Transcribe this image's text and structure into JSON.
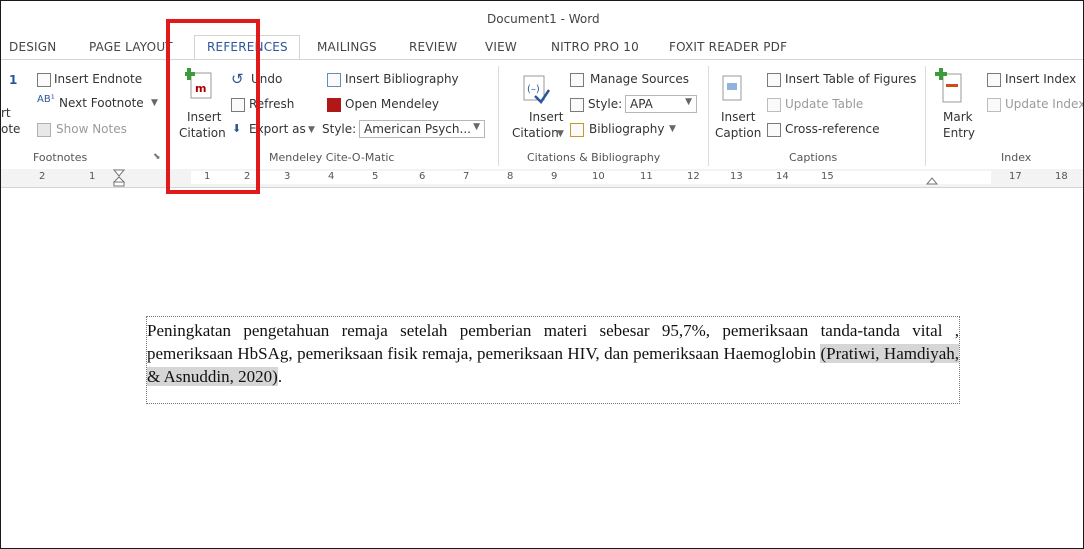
{
  "window": {
    "title": "Document1 - Word"
  },
  "tabs": [
    "DESIGN",
    "PAGE LAYOUT",
    "REFERENCES",
    "MAILINGS",
    "REVIEW",
    "VIEW",
    "NITRO PRO 10",
    "FOXIT READER PDF"
  ],
  "active_tab": "REFERENCES",
  "ribbon": {
    "footnotes": {
      "cut_labels": [
        "1",
        "rt",
        "ote"
      ],
      "insert_endnote": "Insert Endnote",
      "next_footnote": "Next Footnote",
      "show_notes": "Show Notes",
      "group_label": "Footnotes"
    },
    "mendeley": {
      "insert_citation": [
        "Insert",
        "Citation"
      ],
      "undo": "Undo",
      "refresh": "Refresh",
      "export_as": "Export as",
      "insert_bibliography": "Insert Bibliography",
      "open_mendeley": "Open Mendeley",
      "style_label": "Style:",
      "style_value": "American Psych...",
      "group_label": "Mendeley Cite-O-Matic"
    },
    "citations": {
      "insert_citation": [
        "Insert",
        "Citation"
      ],
      "manage_sources": "Manage Sources",
      "style_label": "Style:",
      "style_value": "APA",
      "bibliography": "Bibliography",
      "group_label": "Citations & Bibliography"
    },
    "captions": {
      "insert_caption": [
        "Insert",
        "Caption"
      ],
      "insert_table_of_figures": "Insert Table of Figures",
      "update_table": "Update Table",
      "cross_reference": "Cross-reference",
      "group_label": "Captions"
    },
    "index": {
      "mark_entry": [
        "Mark",
        "Entry"
      ],
      "insert_index": "Insert Index",
      "update_index": "Update Index",
      "group_label": "Index"
    }
  },
  "ruler_numbers": [
    "2",
    "1",
    "1",
    "2",
    "3",
    "4",
    "5",
    "6",
    "7",
    "8",
    "9",
    "10",
    "11",
    "12",
    "13",
    "14",
    "15",
    "17",
    "18"
  ],
  "document": {
    "paragraph_text": "Peningkatan pengetahuan remaja setelah pemberian materi sebesar 95,7%, pemeriksaan tanda-tanda vital , pemeriksaan HbSAg, pemeriksaan fisik remaja, pemeriksaan HIV, dan pemeriksaan Haemoglobin ",
    "citation": "(Pratiwi, Hamdiyah, & Asnuddin, 2020)",
    "trailing": "."
  },
  "colors": {
    "accent": "#2b579a",
    "highlight_box": "#e01a1a",
    "field_shading": "#d6d6d6"
  }
}
